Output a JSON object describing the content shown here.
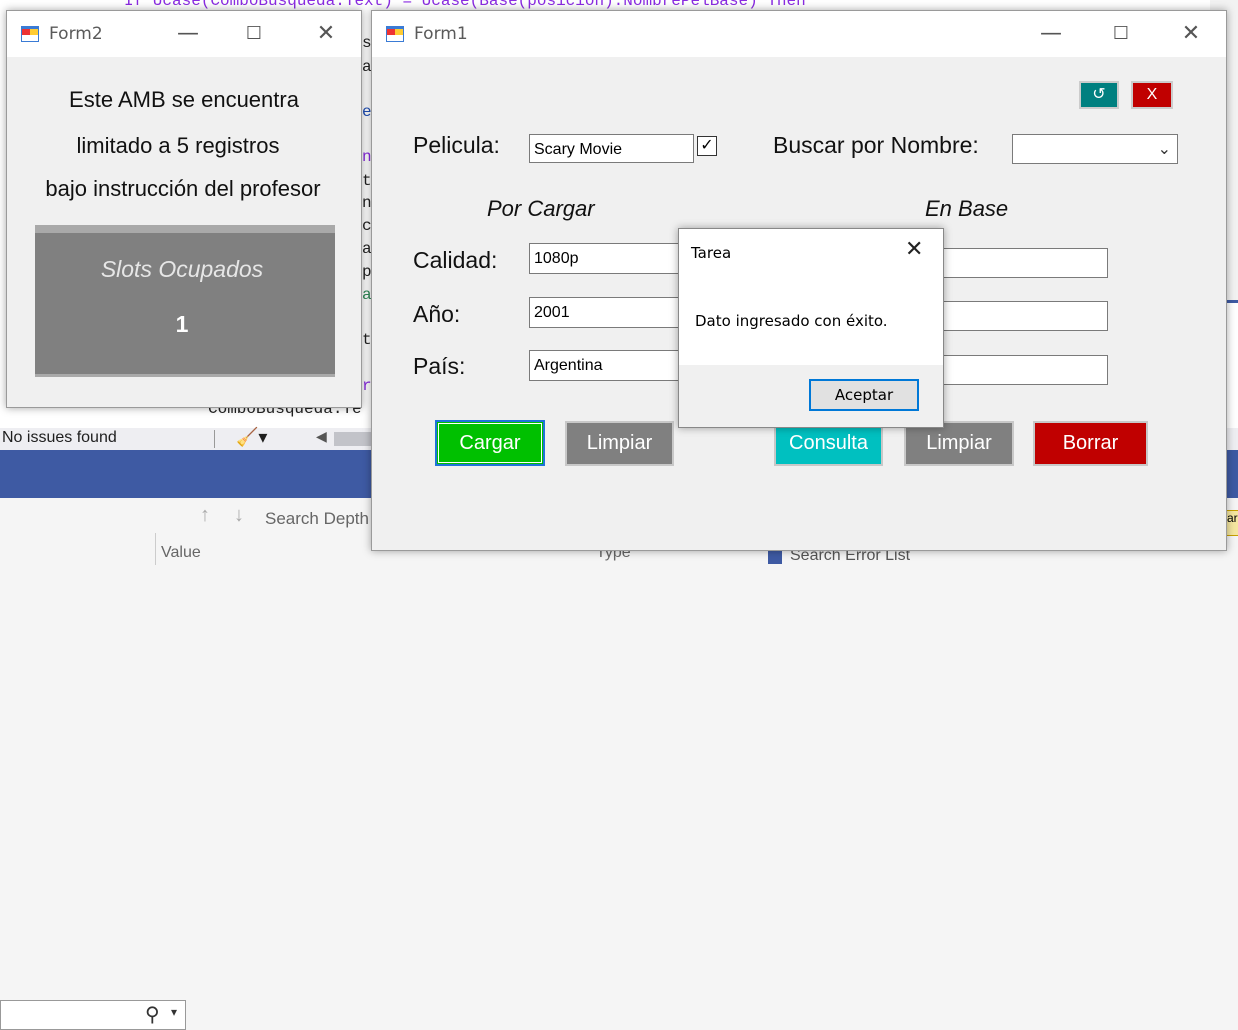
{
  "ide": {
    "code_top": "If Ucase(ComboBusqueda.Text) = Ucase(Base(posicion).NombrePelBase) Then",
    "code_bottom": "ComboBusqueda.Te",
    "status": "No issues found",
    "search_placeholder": "Search Depth",
    "col_value": "Value",
    "col_type": "Type",
    "error_search": "Search Error List",
    "frag_s": "s",
    "frag_a": "a",
    "frag_e": "e",
    "frag_n": "n",
    "frag_t": "t",
    "frag_n2": "n",
    "frag_c": "c",
    "frag_a2": "a",
    "frag_p": "p",
    "frag_a3": "a",
    "frag_t2": "t",
    "frag_ro": "ro",
    "frag_ar": "ar"
  },
  "form2": {
    "title": "Form2",
    "message_line1": "Este AMB se encuentra",
    "message_line2": "limitado a 5 registros",
    "message_line3": "bajo instrucción del profesor",
    "slots_label": "Slots Ocupados",
    "slots_count": "1"
  },
  "form1": {
    "title": "Form1",
    "refresh_icon": "↺",
    "close_x_label": "X",
    "pelicula_label": "Pelicula:",
    "pelicula_value": "Scary Movie",
    "pelicula_checked": true,
    "buscar_label": "Buscar por Nombre:",
    "buscar_value": "",
    "por_cargar": "Por Cargar",
    "en_base": "En Base",
    "calidad_label": "Calidad:",
    "calidad_value": "1080p",
    "anio_label": "Año:",
    "anio_value": "2001",
    "pais_label": "País:",
    "pais_value": "Argentina",
    "base_calidad": "",
    "base_anio": "",
    "base_pais": "",
    "btn_cargar": "Cargar",
    "btn_limpiar1": "Limpiar",
    "btn_consulta": "Consulta",
    "btn_limpiar2": "Limpiar",
    "btn_borrar": "Borrar"
  },
  "dialog": {
    "title": "Tarea",
    "message": "Dato ingresado con éxito.",
    "ok_label": "Aceptar"
  },
  "colors": {
    "cargar": "#00c000",
    "consulta": "#00c0c0",
    "borrar": "#c00000",
    "gray_button": "#808080",
    "teal_icon_button": "#008080",
    "red_icon_button": "#c00000"
  }
}
